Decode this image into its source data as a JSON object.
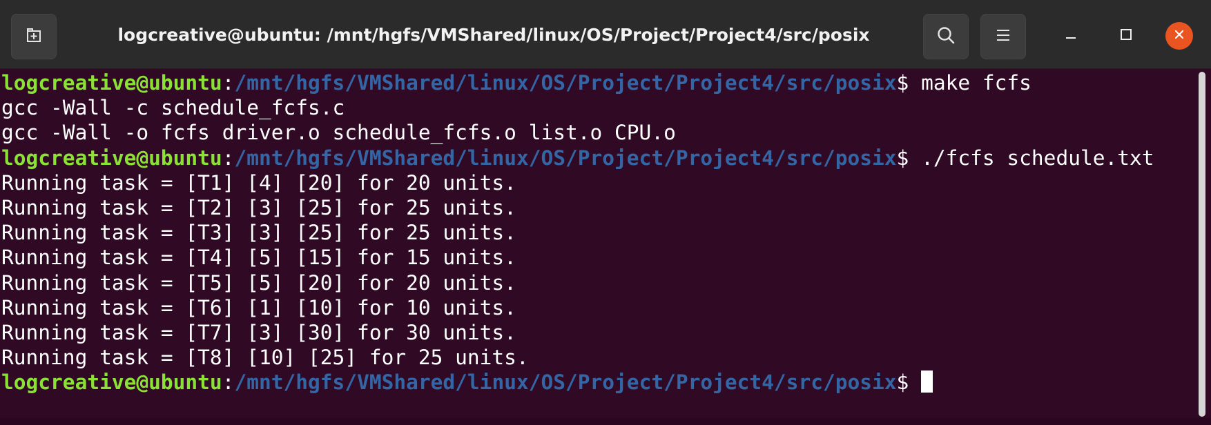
{
  "window": {
    "title": "logcreative@ubuntu: /mnt/hgfs/VMShared/linux/OS/Project/Project4/src/posix",
    "icons": {
      "new_tab": "new-tab-icon",
      "search": "search-icon",
      "menu": "hamburger-menu-icon",
      "minimize": "minimize-icon",
      "maximize": "maximize-icon",
      "close": "close-icon"
    },
    "colors": {
      "titlebar": "#2b2b2b",
      "terminal_bg": "#300a24",
      "prompt_user": "#8ae234",
      "prompt_path": "#3465a4",
      "close_button": "#e95420"
    }
  },
  "terminal": {
    "prompt": {
      "user": "logcreative@ubuntu",
      "colon": ":",
      "path": "/mnt/hgfs/VMShared/linux/OS/Project/Project4/src/posix",
      "symbol": "$"
    },
    "lines": [
      {
        "type": "prompt",
        "command": " make fcfs"
      },
      {
        "type": "output",
        "text": "gcc -Wall -c schedule_fcfs.c"
      },
      {
        "type": "output",
        "text": "gcc -Wall -o fcfs driver.o schedule_fcfs.o list.o CPU.o"
      },
      {
        "type": "prompt",
        "command": " ./fcfs schedule.txt"
      },
      {
        "type": "output",
        "text": "Running task = [T1] [4] [20] for 20 units."
      },
      {
        "type": "output",
        "text": "Running task = [T2] [3] [25] for 25 units."
      },
      {
        "type": "output",
        "text": "Running task = [T3] [3] [25] for 25 units."
      },
      {
        "type": "output",
        "text": "Running task = [T4] [5] [15] for 15 units."
      },
      {
        "type": "output",
        "text": "Running task = [T5] [5] [20] for 20 units."
      },
      {
        "type": "output",
        "text": "Running task = [T6] [1] [10] for 10 units."
      },
      {
        "type": "output",
        "text": "Running task = [T7] [3] [30] for 30 units."
      },
      {
        "type": "output",
        "text": "Running task = [T8] [10] [25] for 25 units."
      },
      {
        "type": "prompt",
        "command": " "
      }
    ]
  }
}
